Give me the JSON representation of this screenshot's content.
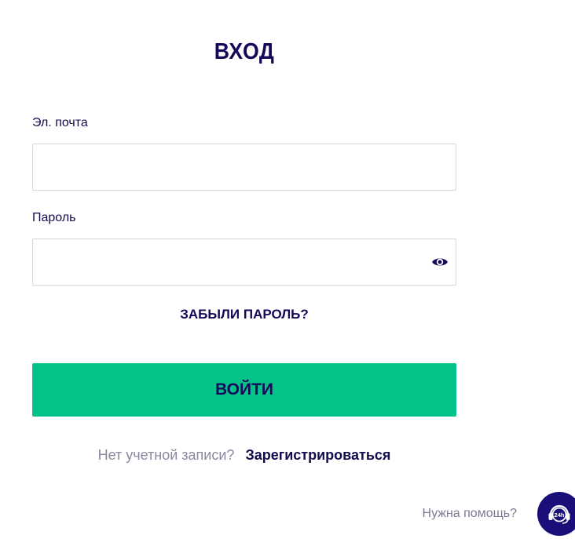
{
  "page": {
    "title": "ВХОД"
  },
  "form": {
    "email_label": "Эл. почта",
    "email_value": "",
    "password_label": "Пароль",
    "password_value": "",
    "forgot_label": "ЗАБЫЛИ ПАРОЛЬ?",
    "submit_label": "ВОЙТИ"
  },
  "register": {
    "prompt": "Нет учетной записи?",
    "link": "Зарегистрироваться"
  },
  "help": {
    "text": "Нужна помощь?",
    "badge": "24h"
  },
  "icons": {
    "password_toggle": "eye-icon",
    "help": "headset-24h-icon"
  },
  "colors": {
    "primary_text": "#13085a",
    "accent": "#03c389",
    "muted": "#8a879f",
    "help_button": "#1a0e7a"
  }
}
